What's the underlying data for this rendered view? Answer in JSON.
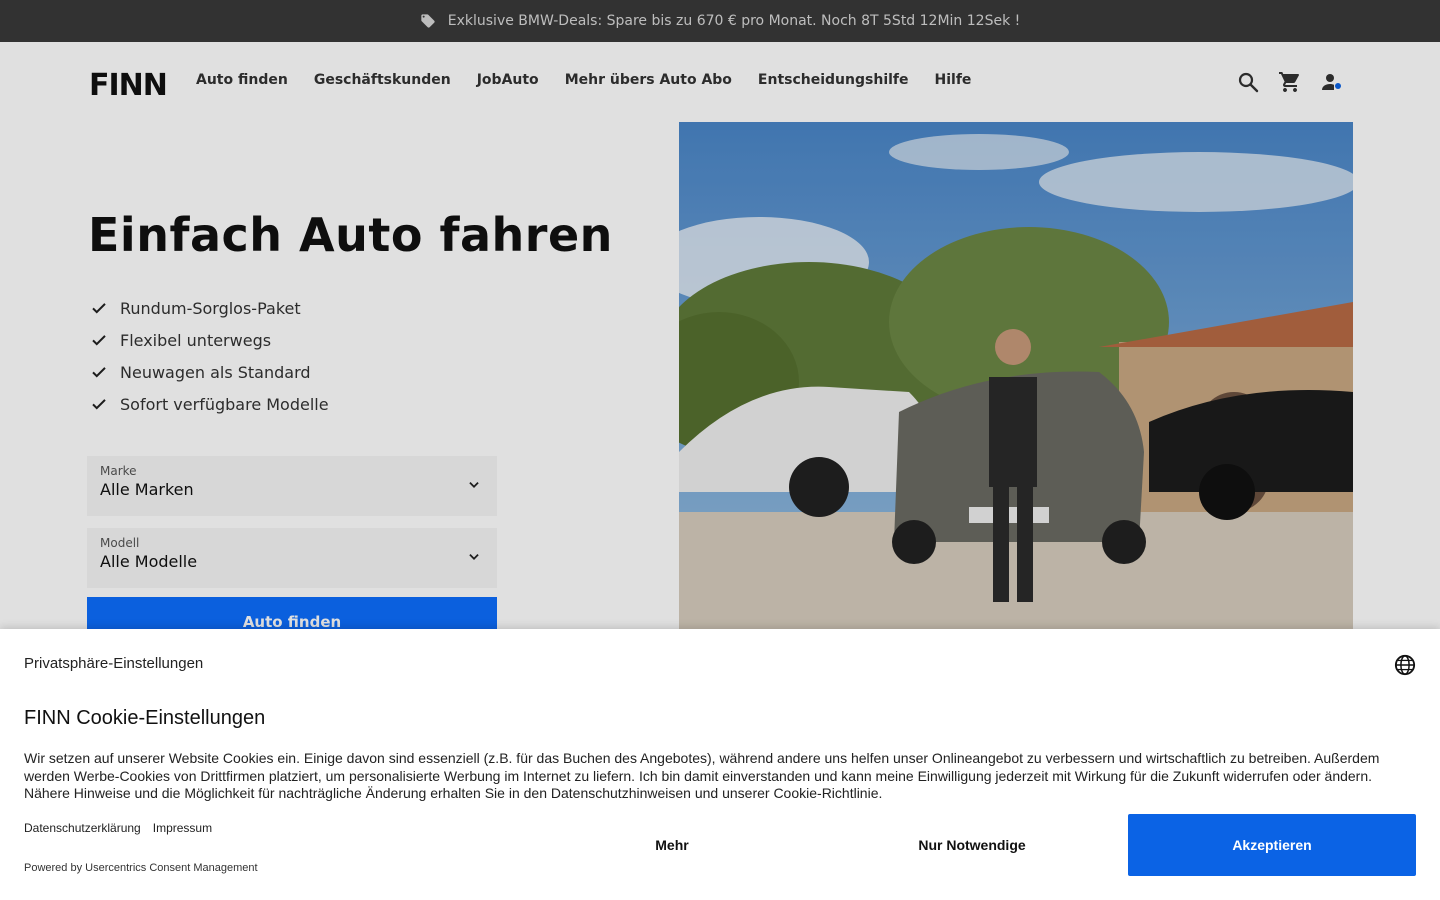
{
  "promo": {
    "text": "Exklusive BMW-Deals: Spare bis zu 670 € pro Monat. Noch  8T 5Std 12Min 12Sek !"
  },
  "header": {
    "logo": "FINN",
    "nav": [
      "Auto finden",
      "Geschäftskunden",
      "JobAuto",
      "Mehr übers Auto Abo",
      "Entscheidungshilfe",
      "Hilfe"
    ],
    "icons": [
      "search-icon",
      "cart-icon",
      "user-icon"
    ]
  },
  "hero": {
    "title": "Einfach Auto fahren",
    "features": [
      "Rundum-Sorglos-Paket",
      "Flexibel unterwegs",
      "Neuwagen als Standard",
      "Sofort verfügbare Modelle"
    ],
    "marke": {
      "label": "Marke",
      "value": "Alle Marken"
    },
    "modell": {
      "label": "Modell",
      "value": "Alle Modelle"
    },
    "button": "Auto finden"
  },
  "cookie": {
    "privacy_title": "Privatsphäre-Einstellungen",
    "title": "FINN Cookie-Einstellungen",
    "description": "Wir setzen auf unserer Website Cookies ein. Einige davon sind essenziell (z.B. für das Buchen des Angebotes), während andere uns helfen unser Onlineangebot zu verbessern und wirtschaftlich zu betreiben. Außerdem werden Werbe-Cookies von Drittfirmen platziert, um personalisierte Werbung im Internet zu liefern. Ich bin damit einverstanden und kann meine Einwilligung jederzeit mit Wirkung für die Zukunft widerrufen oder ändern. Nähere Hinweise und die Möglichkeit für nachträgliche Änderung erhalten Sie in den Datenschutzhinweisen und unserer Cookie-Richtlinie.",
    "link_privacy": "Datenschutzerklärung",
    "link_imprint": "Impressum",
    "powered": "Powered by Usercentrics Consent Management",
    "btn_more": "Mehr",
    "btn_necessary": "Nur Notwendige",
    "btn_accept": "Akzeptieren"
  },
  "colors": {
    "accent": "#0b63e5",
    "promo_bg": "#3a3a3a"
  }
}
